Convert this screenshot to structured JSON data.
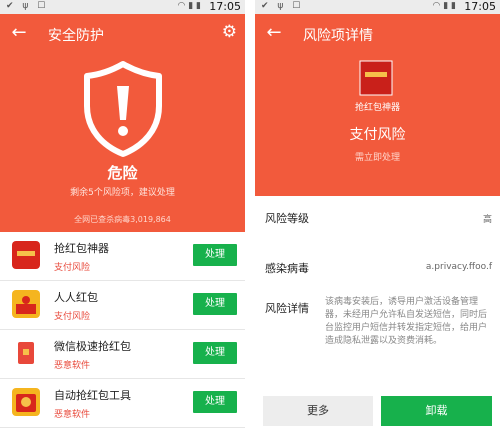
{
  "status_bar": {
    "time": "17:05"
  },
  "left": {
    "title": "安全防护",
    "danger_label": "危险",
    "summary": "剩余5个风险项，建议处理",
    "scan_info": "全网已查杀病毒3,019,864",
    "items": [
      {
        "name": "抢红包神器",
        "risk": "支付风险",
        "action": "处理"
      },
      {
        "name": "人人红包",
        "risk": "支付风险",
        "action": "处理"
      },
      {
        "name": "微信极速抢红包",
        "risk": "恶意软件",
        "action": "处理"
      },
      {
        "name": "自动抢红包工具",
        "risk": "恶意软件",
        "action": "处理"
      }
    ]
  },
  "right": {
    "title": "风险项详情",
    "app_name": "抢红包神器",
    "risk_type": "支付风险",
    "risk_hint": "需立即处理",
    "level_label": "风险等级",
    "level_value": "高",
    "virus_label": "感染病毒",
    "virus_value": "a.privacy.ffoo.f",
    "detail_label": "风险详情",
    "detail_text": "该病毒安装后，诱导用户激活设备管理器，未经用户允许私自发送短信，同时后台监控用户短信并转发指定短信，给用户造成隐私泄露以及资费消耗。",
    "more_button": "更多",
    "uninstall_button": "卸载"
  },
  "colors": {
    "accent_red": "#f25a3c",
    "action_green": "#17b14c"
  },
  "icons": [
    "back-arrow-icon",
    "gear-icon",
    "shield-warning-icon",
    "wifi-icon",
    "signal-icon",
    "battery-icon",
    "usb-icon"
  ]
}
